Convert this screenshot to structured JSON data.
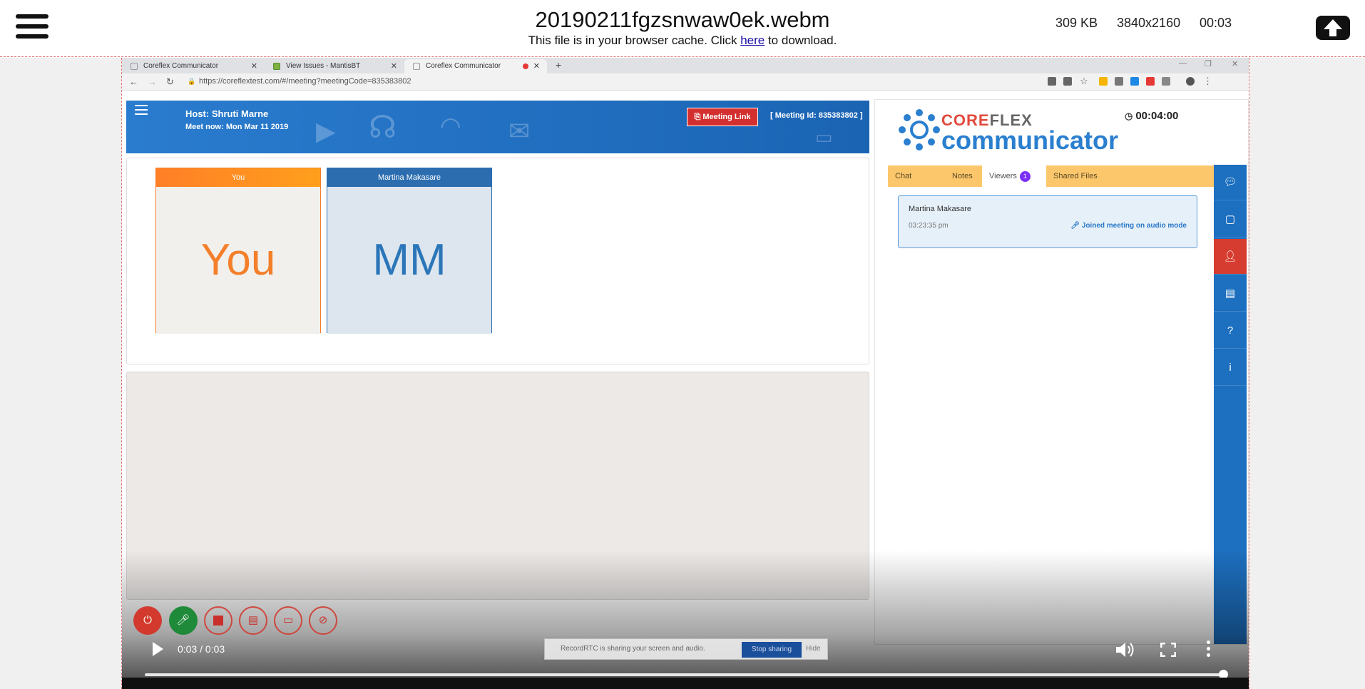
{
  "viewer": {
    "filename": "20190211fgzsnwaw0ek.webm",
    "cache_text_before": "This file is in your browser cache. Click ",
    "cache_link": "here",
    "cache_text_after": " to download.",
    "size": "309 KB",
    "resolution": "3840x2160",
    "duration": "00:03"
  },
  "browser": {
    "tabs": [
      {
        "label": "Coreflex Communicator"
      },
      {
        "label": "View Issues - MantisBT"
      },
      {
        "label": "Coreflex Communicator"
      }
    ],
    "new_tab": "+",
    "url": "https://coreflextest.com/#/meeting?meetingCode=835383802"
  },
  "app": {
    "host": "Host: Shruti Marne",
    "meet_now": "Meet now: Mon Mar 11 2019",
    "meeting_link_label": "Meeting Link",
    "meeting_id": "[ Meeting Id: 835383802 ]",
    "participants": [
      {
        "header": "You",
        "initials": "You"
      },
      {
        "header": "Martina Makasare",
        "initials": "MM"
      }
    ],
    "brand_part1": "CORE",
    "brand_part2": "FLEX",
    "brand_bottom": "communicator",
    "timer": "00:04:00",
    "tabs": {
      "chat": "Chat",
      "notes": "Notes",
      "viewers": "Viewers",
      "viewers_count": "1",
      "shared": "Shared Files"
    },
    "viewer_card": {
      "name": "Martina Makasare",
      "time": "03:23:35 pm",
      "status": "Joined meeting on audio mode"
    },
    "sharing_bar": {
      "text": "RecordRTC is sharing your screen and audio.",
      "stop": "Stop sharing",
      "hide": "Hide"
    }
  },
  "player": {
    "time": "0:03 / 0:03",
    "progress": 1.0
  }
}
